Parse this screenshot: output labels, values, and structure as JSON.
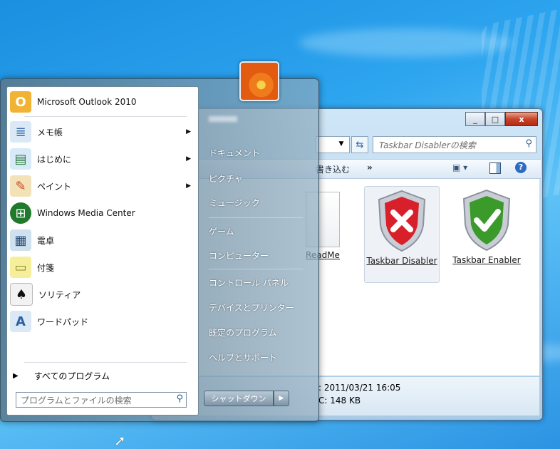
{
  "explorer": {
    "search_placeholder": "Taskbar Disablerの検索",
    "toolbar_burn": "書き込む",
    "toolbar_more": "»",
    "files": [
      {
        "label": "ReadMe",
        "icon": "document-icon"
      },
      {
        "label": "Taskbar Disabler",
        "icon": "red-shield-x-icon",
        "selected": true
      },
      {
        "label": "Taskbar Enabler",
        "icon": "green-shield-check-icon"
      }
    ],
    "details": {
      "date": ": 2011/03/21 16:05",
      "size": "C: 148 KB"
    },
    "window_buttons": {
      "minimize": "_",
      "maximize": "□",
      "close": "x"
    }
  },
  "start_menu": {
    "programs": [
      {
        "label": "Microsoft Outlook 2010",
        "icon": "outlook-icon",
        "submenu": false
      },
      {
        "label": "メモ帳",
        "icon": "notepad-icon",
        "submenu": true
      },
      {
        "label": "はじめに",
        "icon": "getting-started-icon",
        "submenu": true
      },
      {
        "label": "ペイント",
        "icon": "paint-icon",
        "submenu": true
      },
      {
        "label": "Windows Media Center",
        "icon": "media-center-icon",
        "submenu": false
      },
      {
        "label": "電卓",
        "icon": "calculator-icon",
        "submenu": false
      },
      {
        "label": "付箋",
        "icon": "sticky-notes-icon",
        "submenu": false
      },
      {
        "label": "ソリティア",
        "icon": "solitaire-icon",
        "submenu": false
      },
      {
        "label": "ワードパッド",
        "icon": "wordpad-icon",
        "submenu": false
      }
    ],
    "all_programs": "すべてのプログラム",
    "search_placeholder": "プログラムとファイルの検索",
    "right_items": [
      "ドキュメント",
      "ピクチャ",
      "ミュージック",
      "ゲーム",
      "コンピューター",
      "コントロール パネル",
      "デバイスとプリンター",
      "既定のプログラム",
      "ヘルプとサポート"
    ],
    "shutdown": "シャットダウン",
    "shutdown_arrow": "▶",
    "submenu_arrow": "▶"
  },
  "colors": {
    "desktop": "#2ea5ef",
    "close_button": "#c7442a",
    "shield_red": "#d8202a",
    "shield_green": "#3a9a2a"
  }
}
